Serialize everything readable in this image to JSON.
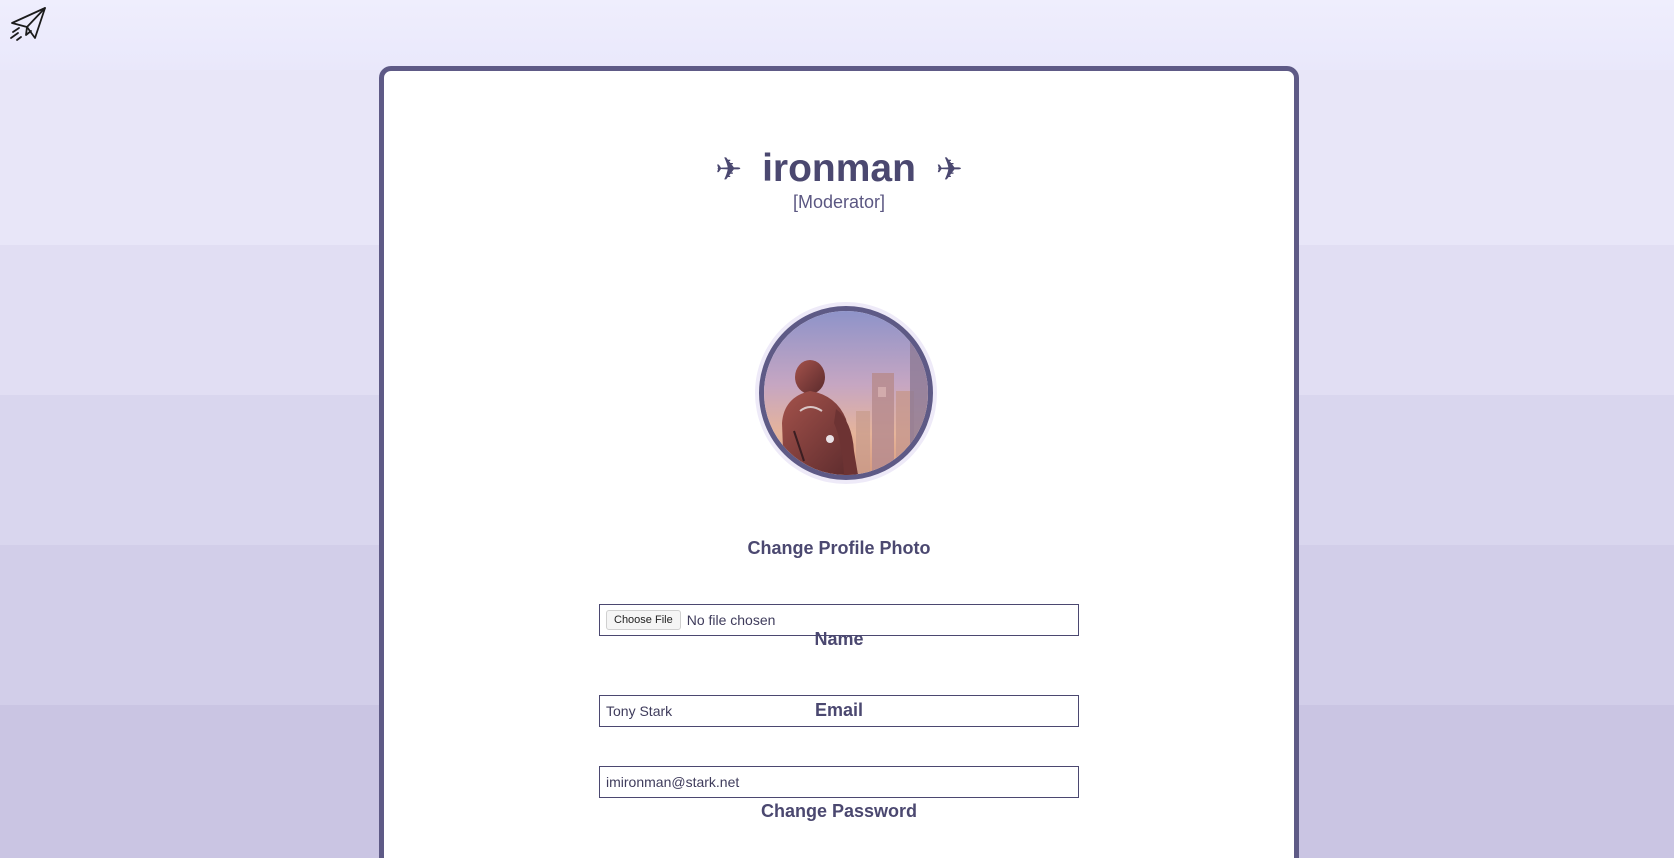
{
  "header": {
    "logo_icon": "paper-plane-icon"
  },
  "profile": {
    "title_left_glyph": "✈",
    "username": "ironman",
    "title_right_glyph": "✈",
    "role": "[Moderator]",
    "avatar_alt": "avatar"
  },
  "form": {
    "photo_label": "Change Profile Photo",
    "choose_file_label": "Choose File",
    "file_status": "No file chosen",
    "name_label": "Name",
    "name_value": "Tony Stark",
    "email_label": "Email",
    "email_value": "imironman@stark.net",
    "password_label": "Change Password"
  },
  "colors": {
    "accent": "#5e5a86",
    "text": "#4b4870",
    "background": "#e6e4f6"
  }
}
